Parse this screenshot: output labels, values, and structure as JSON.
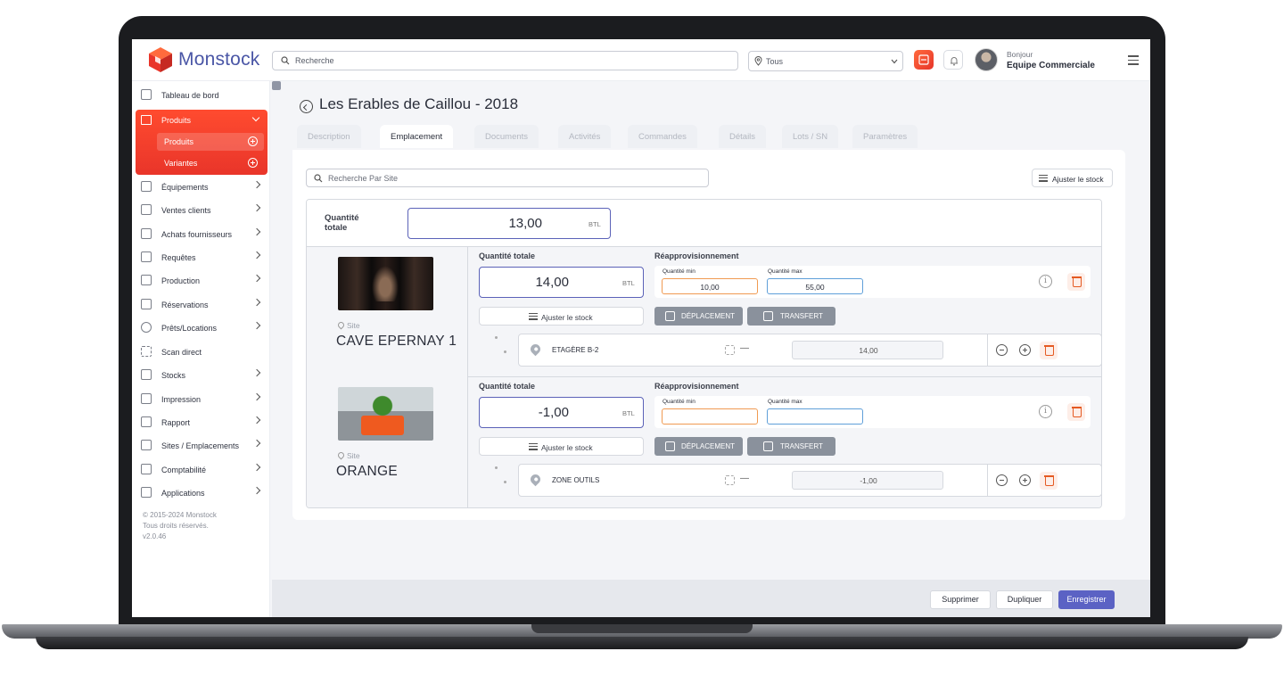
{
  "app": {
    "name": "Monstock",
    "search_placeholder": "Recherche",
    "site_filter": "Tous",
    "greeting": "Bonjour",
    "user_name": "Equipe Commerciale"
  },
  "sidebar": {
    "items": [
      {
        "label": "Tableau de bord",
        "icon": "dashboard-icon",
        "has_chevron": false
      },
      {
        "label": "Équipements",
        "icon": "wrench-icon",
        "has_chevron": true
      },
      {
        "label": "Ventes clients",
        "icon": "store-icon",
        "has_chevron": true
      },
      {
        "label": "Achats fournisseurs",
        "icon": "shop-icon",
        "has_chevron": true
      },
      {
        "label": "Requêtes",
        "icon": "chat-icon",
        "has_chevron": true
      },
      {
        "label": "Production",
        "icon": "factory-icon",
        "has_chevron": true
      },
      {
        "label": "Réservations",
        "icon": "calendar-icon",
        "has_chevron": true
      },
      {
        "label": "Prêts/Locations",
        "icon": "pin-icon",
        "has_chevron": true
      },
      {
        "label": "Scan direct",
        "icon": "scan-icon",
        "has_chevron": false
      },
      {
        "label": "Stocks",
        "icon": "warehouse-icon",
        "has_chevron": true
      },
      {
        "label": "Impression",
        "icon": "printer-icon",
        "has_chevron": true
      },
      {
        "label": "Rapport",
        "icon": "tag-icon",
        "has_chevron": true
      },
      {
        "label": "Sites / Emplacements",
        "icon": "building-icon",
        "has_chevron": true
      },
      {
        "label": "Comptabilité",
        "icon": "ledger-icon",
        "has_chevron": true
      },
      {
        "label": "Applications",
        "icon": "clipboard-icon",
        "has_chevron": true
      }
    ],
    "products_group": {
      "label": "Produits",
      "sub_items": [
        {
          "label": "Produits",
          "active": true
        },
        {
          "label": "Variantes",
          "active": false
        }
      ]
    },
    "copyright": [
      "© 2015-2024 Monstock",
      "Tous droits réservés.",
      "v2.0.46"
    ]
  },
  "page": {
    "title": "Les Erables de Caillou - 2018",
    "tabs": [
      "Description",
      "Emplacement",
      "Documents",
      "Activités",
      "Commandes",
      "Détails",
      "Lots / SN",
      "Paramètres"
    ],
    "active_tab": "Emplacement",
    "site_search_placeholder": "Recherche Par Site",
    "adjust_stock_label": "Ajuster le stock",
    "total_label": "Quantité totale",
    "total_value": "13,00",
    "unit": "BTL",
    "col_total_label": "Quantité totale",
    "col_reappro_label": "Réapprovisionnement",
    "min_label": "Quantité min",
    "max_label": "Quantité max",
    "site_caption": "Site",
    "move_label": "DÉPLACEMENT",
    "transfer_label": "TRANSFERT",
    "sites": [
      {
        "name": "CAVE EPERNAY 1",
        "quantity": "14,00",
        "min": "10,00",
        "max": "55,00",
        "location": "ETAGÈRE B-2",
        "location_qty": "14,00",
        "location_extra": "—"
      },
      {
        "name": "ORANGE",
        "quantity": "-1,00",
        "min": "",
        "max": "",
        "location": "ZONE OUTILS",
        "location_qty": "-1,00",
        "location_extra": "—"
      }
    ]
  },
  "footer": {
    "delete_label": "Supprimer",
    "duplicate_label": "Dupliquer",
    "save_label": "Enregistrer"
  },
  "colors": {
    "brand_orange": "#e9352a",
    "accent_indigo": "#5b62c4",
    "min_border": "#f09a52",
    "max_border": "#5f9fd9"
  }
}
